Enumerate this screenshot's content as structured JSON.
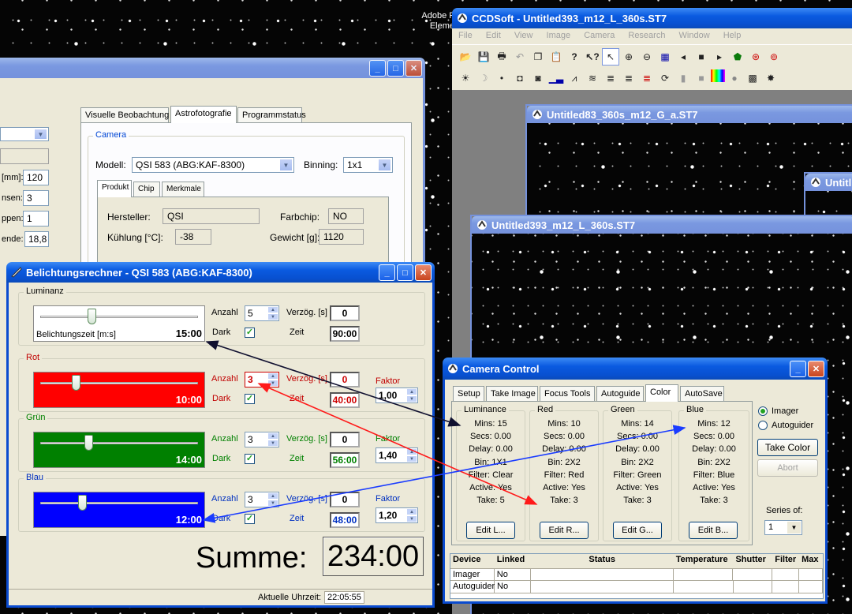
{
  "desktop": {
    "adobe_label": "Adobe F\nEleme"
  },
  "dialog_bg": {
    "tabs": [
      "Visuelle Beobachtung",
      "Astrofotografie",
      "Programmstatus"
    ],
    "camera_group": "Camera",
    "modell_label": "Modell:",
    "modell_value": "QSI 583 (ABG:KAF-8300)",
    "binning_label": "Binning:",
    "binning_value": "1x1",
    "subtabs": [
      "Produkt",
      "Chip",
      "Merkmale"
    ],
    "hersteller_label": "Hersteller:",
    "hersteller_value": "QSI",
    "farbchip_label": "Farbchip:",
    "farbchip_value": "NO",
    "kuehlung_label": "Kühlung [°C]:",
    "kuehlung_value": "-38",
    "gewicht_label": "Gewicht [g]:",
    "gewicht_value": "1120",
    "left_labels": [
      "[mm]:",
      "nsen:",
      "ppen:",
      "ende:"
    ],
    "left_values": [
      "120",
      "3",
      "1",
      "18,8"
    ]
  },
  "rechner": {
    "title": "Belichtungsrechner - QSI 583 (ABG:KAF-8300)",
    "anzahl_label": "Anzahl",
    "verzoeg_label": "Verzög. [s]",
    "dark_label": "Dark",
    "zeit_label": "Zeit",
    "faktor_label": "Faktor",
    "belichtungszeit_label": "Belichtungszeit [m:s]",
    "channels": [
      {
        "name": "Luminanz",
        "time": "15:00",
        "anzahl": "5",
        "verzoeg": "0",
        "zeit": "90:00",
        "faktor": "",
        "level": 0.3
      },
      {
        "name": "Rot",
        "time": "10:00",
        "anzahl": "3",
        "verzoeg": "0",
        "zeit": "40:00",
        "faktor": "1,00",
        "level": 0.2
      },
      {
        "name": "Grün",
        "time": "14:00",
        "anzahl": "3",
        "verzoeg": "0",
        "zeit": "56:00",
        "faktor": "1,40",
        "level": 0.28
      },
      {
        "name": "Blau",
        "time": "12:00",
        "anzahl": "3",
        "verzoeg": "0",
        "zeit": "48:00",
        "faktor": "1,20",
        "level": 0.24
      }
    ],
    "summe_label": "Summe:",
    "summe_value": "234:00",
    "uhrzeit_label": "Aktuelle Uhrzeit:",
    "uhrzeit_value": "22:05:55"
  },
  "ccdsoft": {
    "title": "CCDSoft   - Untitled393_m12_L_360s.ST7",
    "menu": [
      "File",
      "Edit",
      "View",
      "Image",
      "Camera",
      "Research",
      "Window",
      "Help"
    ],
    "doc1_title": "Untitled83_360s_m12_G_a.ST7",
    "doc2_title": "Untitl",
    "doc3_title": "Untitled393_m12_L_360s.ST7"
  },
  "camera_control": {
    "title": "Camera Control",
    "tabs": [
      "Setup",
      "Take Image",
      "Focus Tools",
      "Autoguide",
      "Color",
      "AutoSave"
    ],
    "columns": [
      {
        "name": "Luminance",
        "mins": "Mins: 15",
        "secs": "Secs: 0.00",
        "delay": "Delay: 0.00",
        "bin": "Bin: 1X1",
        "filter": "Filter: Clear",
        "active": "Active: Yes",
        "take": "Take: 5",
        "edit": "Edit L..."
      },
      {
        "name": "Red",
        "mins": "Mins: 10",
        "secs": "Secs: 0.00",
        "delay": "Delay: 0.00",
        "bin": "Bin: 2X2",
        "filter": "Filter: Red",
        "active": "Active: Yes",
        "take": "Take: 3",
        "edit": "Edit R..."
      },
      {
        "name": "Green",
        "mins": "Mins: 14",
        "secs": "Secs: 0.00",
        "delay": "Delay: 0.00",
        "bin": "Bin: 2X2",
        "filter": "Filter: Green",
        "active": "Active: Yes",
        "take": "Take: 3",
        "edit": "Edit G..."
      },
      {
        "name": "Blue",
        "mins": "Mins: 12",
        "secs": "Secs: 0.00",
        "delay": "Delay: 0.00",
        "bin": "Bin: 2X2",
        "filter": "Filter: Blue",
        "active": "Active: Yes",
        "take": "Take: 3",
        "edit": "Edit B..."
      }
    ],
    "radio_imager": "Imager",
    "radio_autoguider": "Autoguider",
    "take_color": "Take Color",
    "abort": "Abort",
    "series_label": "Series of:",
    "series_value": "1",
    "grid_headers": [
      "Device",
      "Linked",
      "Status",
      "Temperature",
      "Shutter",
      "Filter",
      "Max"
    ],
    "grid_rows": [
      {
        "device": "Imager",
        "linked": "No"
      },
      {
        "device": "Autoguider",
        "linked": "No"
      }
    ]
  },
  "colors": {
    "rot": "#ff0000",
    "gruen": "#008000",
    "blau": "#0000ff",
    "arrow_black": "#101030",
    "arrow_red": "#ff1a1a",
    "arrow_blue": "#1a3cff"
  }
}
